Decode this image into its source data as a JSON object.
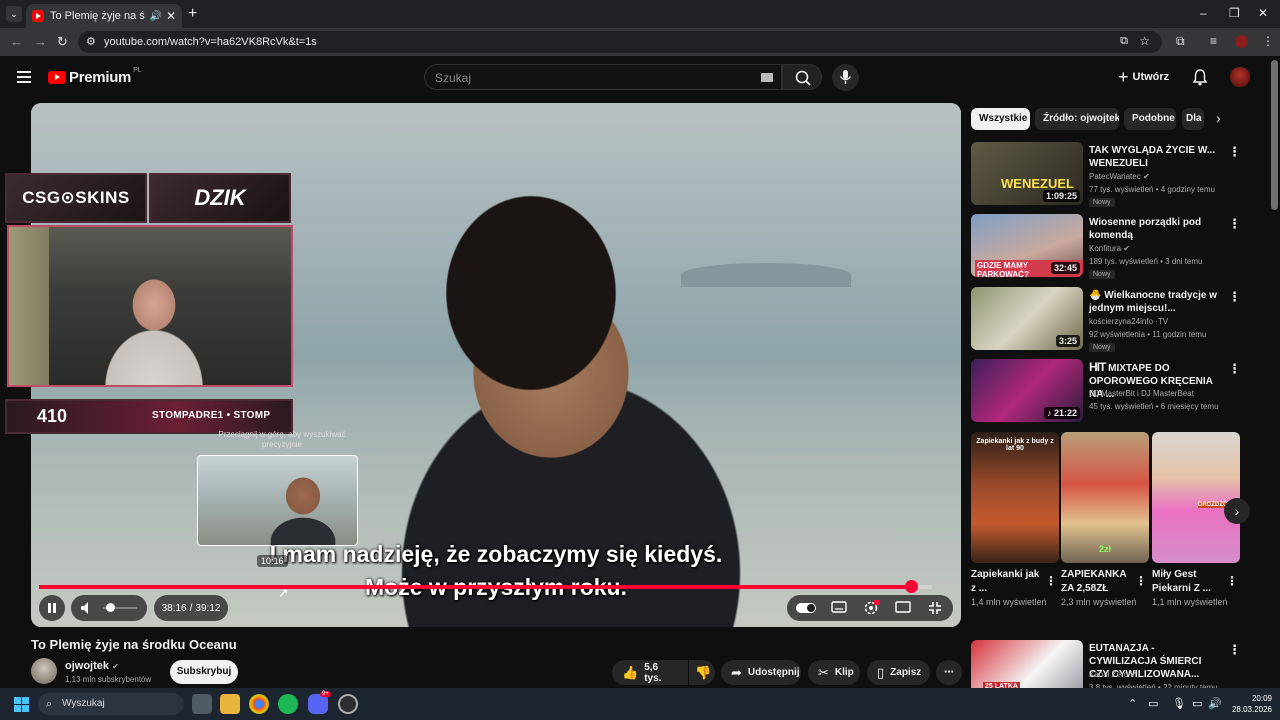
{
  "browser": {
    "tab_title": "To Plemię żyje na środku Oceanu",
    "url": "youtube.com/watch?v=ha62VK8RcVk&t=1s"
  },
  "header": {
    "brand": "Premium",
    "region": "PL",
    "search_placeholder": "Szukaj",
    "create_label": "Utwórz"
  },
  "player": {
    "overlay_sponsor_1": "CSG⊙SKINS",
    "overlay_sponsor_2": "DZIK",
    "overlay_count": "410",
    "overlay_handles": "STOMPADRE1 • STOMP",
    "seek_hint": "Przeciągnij w górę, aby wyszukiwać precyzyjnie",
    "preview_time": "10:16",
    "subtitle_line_1": "I mam nadzieję, że zobaczymy się kiedyś.",
    "subtitle_line_2": "Może w przyszłym roku.",
    "current_time": "38:16",
    "duration": "39:12",
    "progress": 0.976,
    "volume": 0.1,
    "accent_color": "#ff0033"
  },
  "video": {
    "title": "To Plemię żyje na środku Oceanu",
    "channel": "ojwojtek",
    "subscribers": "1,13 mln subskrybentów",
    "subscribe_label": "Subskrybuj",
    "likes": "5,6 tys.",
    "share_label": "Udostępnij",
    "clip_label": "Klip",
    "save_label": "Zapisz"
  },
  "chips": [
    "Wszystkie",
    "Źródło: ojwojtek",
    "Podobne",
    "Dla"
  ],
  "recommendations": [
    {
      "title": "TAK WYGLĄDA ŻYCIE W... WENEZUELI",
      "channel": "PatecWariatec",
      "verified": true,
      "meta": "77 tys. wyświetleń • 4 godziny temu",
      "badge": "Nowy",
      "duration": "1:09:25",
      "thumb_text": "WENEZUEL"
    },
    {
      "title": "Wiosenne porządki pod komendą",
      "channel": "Konfitura",
      "verified": true,
      "meta": "189 tys. wyświetleń • 3 dni temu",
      "badge": "Nowy",
      "duration": "32:45",
      "thumb_text": "GDZIE MAMY PARKOWAĆ?"
    },
    {
      "title": "Wielkanocne tradycje w jednym miejscu!...",
      "channel": "kościerzyna24info ·TV",
      "verified": false,
      "meta": "92 wyświetlenia • 11 godzin temu",
      "badge": "Nowy",
      "duration": "3:25",
      "thumb_text": ""
    },
    {
      "title": "MIXTAPE DO OPOROWEGO KRĘCENIA NA ...",
      "title_prefix": "HIT",
      "channel": "DJ MasterBit i DJ MasterBeat",
      "verified": false,
      "meta": "45 tys. wyświetleń • 6 miesięcy temu",
      "badge": "",
      "duration": "21:22",
      "thumb_text": ""
    },
    {
      "title": "EUTANAZJA - CYWILIZACJA ŚMIERCI CZY CYWILIZOWANA...",
      "channel": "Kanał Zero",
      "verified": true,
      "meta": "3,8 tys. wyświetleń • 22 minuty temu",
      "badge": "",
      "duration": "",
      "thumb_text": "25 LATKA"
    }
  ],
  "shorts": [
    {
      "title": "Zapiekanki jak z ...",
      "views": "1,4 mln wyświetleń",
      "thumb_text": "Zapiekanki jak z budy z lat 90"
    },
    {
      "title": "ZAPIEKANKA ZA 2,58ZŁ",
      "views": "2,3 mln wyświetleń",
      "thumb_text": "2zł"
    },
    {
      "title": "Miły Gest Piekarni Z ...",
      "views": "1,1 mln wyświetleń",
      "thumb_text": "DROŻDŻÓWKA"
    }
  ],
  "taskbar": {
    "search_label": "Wyszukaj",
    "time": "20:09",
    "date": "28.03.2026",
    "discord_badge": "9+"
  }
}
